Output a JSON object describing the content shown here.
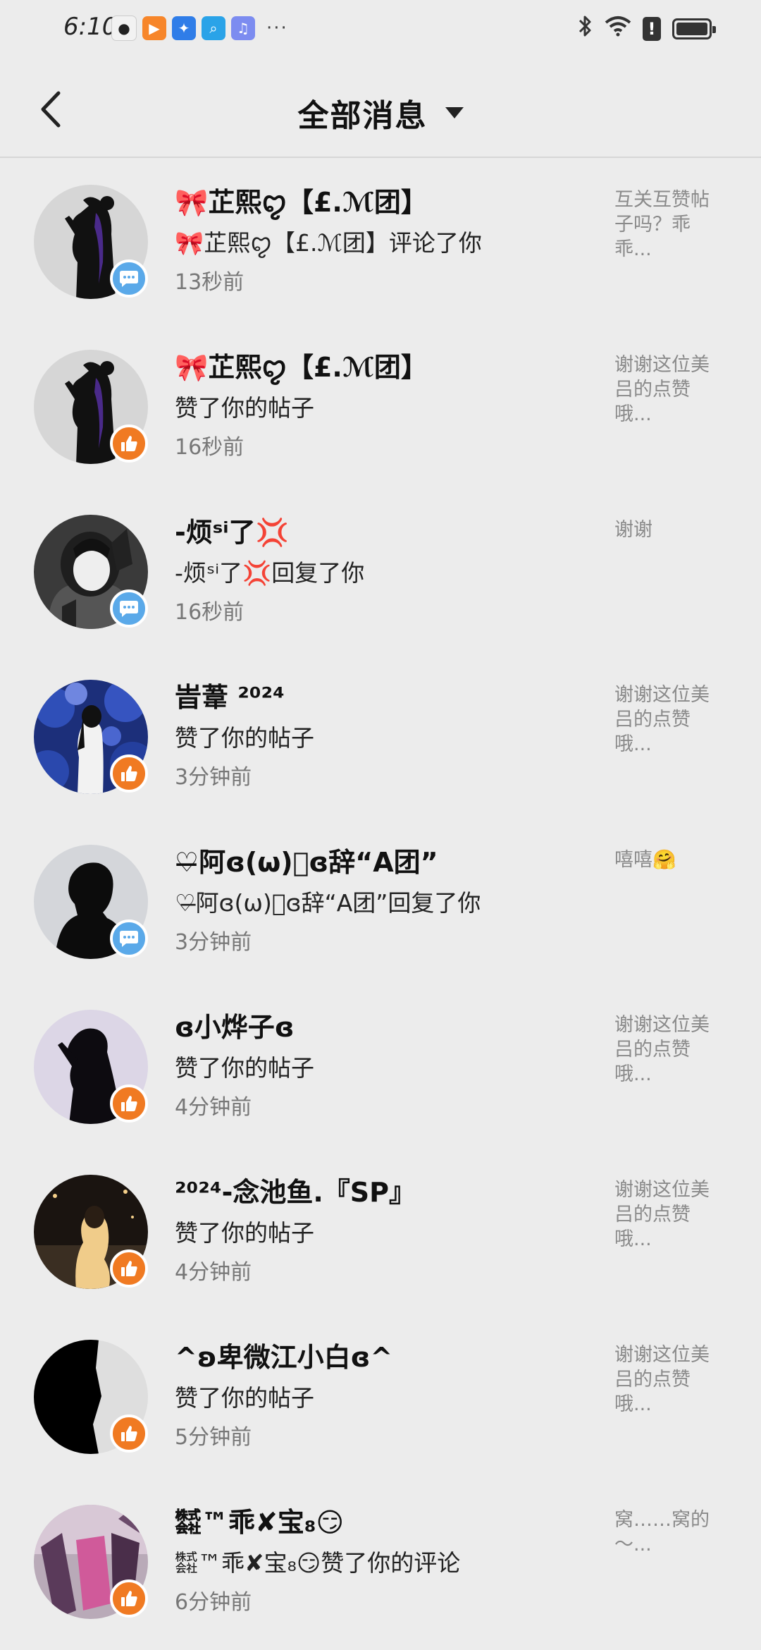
{
  "status_bar": {
    "time": "6:10",
    "app_icons": [
      {
        "name": "app-icon-1",
        "glyph": "●",
        "color": "#f2f2f2",
        "fg": "#222"
      },
      {
        "name": "app-icon-2",
        "glyph": "▶",
        "color": "#f7862a",
        "fg": "#fff"
      },
      {
        "name": "app-icon-3",
        "glyph": "✦",
        "color": "#2f7de8",
        "fg": "#fff"
      },
      {
        "name": "app-icon-4",
        "glyph": "⌕",
        "color": "#2aa3e8",
        "fg": "#fff"
      },
      {
        "name": "app-icon-5",
        "glyph": "♫",
        "color": "#7c8cf0",
        "fg": "#fff"
      }
    ],
    "more": "···",
    "alert": "!"
  },
  "header": {
    "title": "全部消息"
  },
  "colors": {
    "comment_badge": "#5aa9e9",
    "like_badge": "#f07a22",
    "background": "#ececec"
  },
  "messages": [
    {
      "name": "🎀芷熙ꨄ【£.ℳ团】",
      "action": "🎀芷熙ꨄ【£.ℳ团】评论了你",
      "time": "13秒前",
      "preview": "互关互赞帖子吗？乖乖...",
      "badge": "comment"
    },
    {
      "name": "🎀芷熙ꨄ【£.ℳ团】",
      "action": "赞了你的帖子",
      "time": "16秒前",
      "preview": "谢谢这位美吕的点赞哦...",
      "badge": "like"
    },
    {
      "name": "-烦ˢⁱ了💢",
      "action": "-烦ˢⁱ了💢回复了你",
      "time": "16秒前",
      "preview": "谢谢",
      "badge": "comment"
    },
    {
      "name": "旹葦 ²⁰²⁴",
      "action": "赞了你的帖子",
      "time": "3分钟前",
      "preview": "谢谢这位美吕的点赞哦...",
      "badge": "like"
    },
    {
      "name": "♡̶阿ɞ(ω)⃝ɞ辞“A团”",
      "action": "♡̶阿ɞ(ω)⃝ɞ辞“A团”回复了你",
      "time": "3分钟前",
      "preview": "嘻嘻🤗",
      "badge": "comment"
    },
    {
      "name": "ɞ小烨子ɞ",
      "action": "赞了你的帖子",
      "time": "4分钟前",
      "preview": "谢谢这位美吕的点赞哦...",
      "badge": "like"
    },
    {
      "name": "²⁰²⁴-念池鱼.『SP』",
      "action": "赞了你的帖子",
      "time": "4分钟前",
      "preview": "谢谢这位美吕的点赞哦...",
      "badge": "like"
    },
    {
      "name": "^ʚ卑微江小白ɞ^",
      "action": "赞了你的帖子",
      "time": "5分钟前",
      "preview": "谢谢这位美吕的点赞哦...",
      "badge": "like"
    },
    {
      "name": "㍿™乖✘宝₈😏",
      "action": "㍿™乖✘宝₈😏赞了你的评论",
      "time": "6分钟前",
      "preview": "窝……窝的～...",
      "badge": "like"
    }
  ]
}
